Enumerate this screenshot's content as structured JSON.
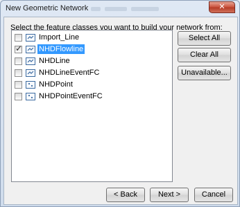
{
  "window": {
    "title": "New Geometric Network",
    "close_glyph": "✕"
  },
  "instruction": "Select the feature classes you want to build your network from:",
  "feature_classes": [
    {
      "label": "Import_Line",
      "checked": false,
      "icon": "line-feature-class-icon"
    },
    {
      "label": "NHDFlowline",
      "checked": true,
      "selected": true,
      "icon": "line-feature-class-icon"
    },
    {
      "label": "NHDLine",
      "checked": false,
      "icon": "line-feature-class-icon"
    },
    {
      "label": "NHDLineEventFC",
      "checked": false,
      "icon": "line-feature-class-icon"
    },
    {
      "label": "NHDPoint",
      "checked": false,
      "icon": "point-feature-class-icon"
    },
    {
      "label": "NHDPointEventFC",
      "checked": false,
      "icon": "point-feature-class-icon"
    }
  ],
  "side_buttons": {
    "select_all": "Select All",
    "clear_all": "Clear All",
    "unavailable": "Unavailable..."
  },
  "nav_buttons": {
    "back": "< Back",
    "next": "Next >",
    "cancel": "Cancel"
  },
  "colors": {
    "selection": "#3399ff",
    "icon_stroke": "#3b6aa0"
  }
}
